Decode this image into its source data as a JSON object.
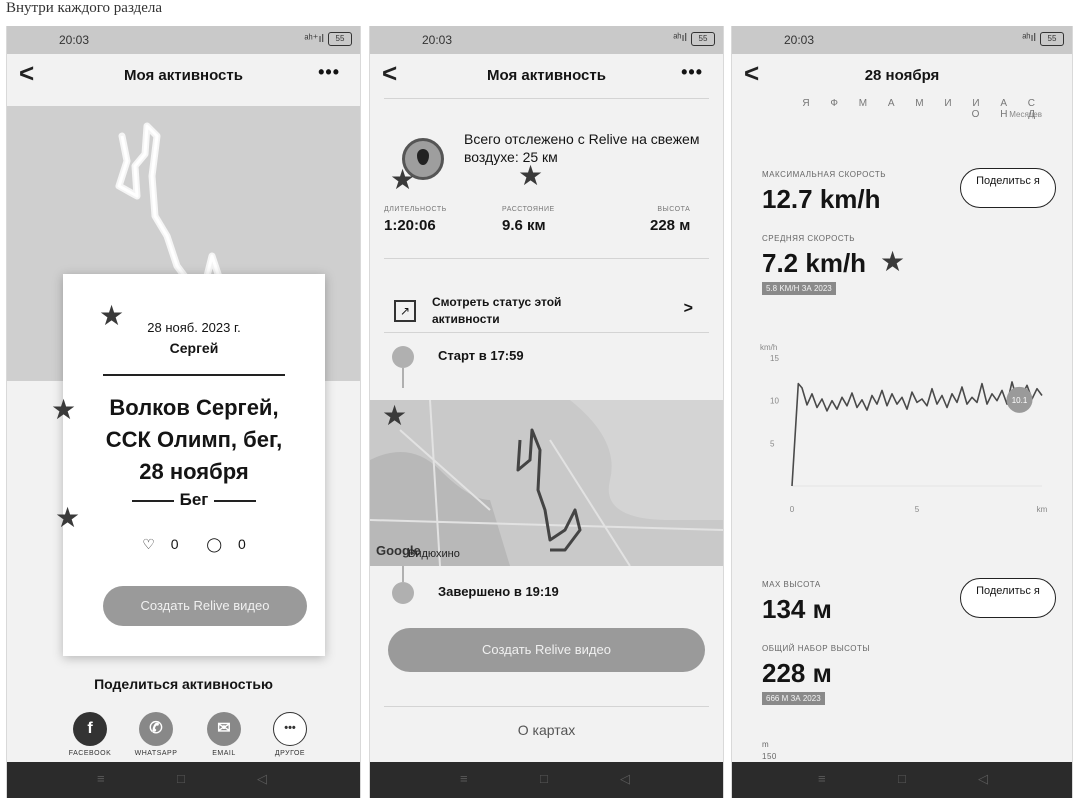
{
  "header_text": "Внутри каждого раздела",
  "screens": [
    {
      "status_time": "20:03",
      "status_signal": "ᵃʰ⁺ıl",
      "status_battery": "55",
      "title": "Моя активность",
      "more": "•••",
      "back": "<",
      "card": {
        "date": "28 нояб. 2023 г.",
        "name": "Сергей",
        "title_lines": [
          "Волков Сергей,",
          "ССК Олимп, бег,",
          "28 ноября"
        ],
        "sport": "Бег",
        "likes": "0",
        "comments": "0",
        "button": "Создать Relive видео"
      },
      "share_title": "Поделиться активностью",
      "share_options": [
        {
          "label": "FACEBOOK",
          "glyph": "f",
          "icon": "facebook-icon"
        },
        {
          "label": "WHATSAPP",
          "glyph": "✆",
          "icon": "whatsapp-icon"
        },
        {
          "label": "EMAIL",
          "glyph": "✉",
          "icon": "email-icon"
        },
        {
          "label": "ДРУГОЕ",
          "glyph": "•••",
          "icon": "more-icon"
        }
      ]
    },
    {
      "status_time": "20:03",
      "status_signal": "ᵃʰıl",
      "status_battery": "55",
      "title": "Моя активность",
      "more": "•••",
      "back": "<",
      "tracked_text": "Всего отслежено с Relive на свежем воздухе: 25 км",
      "stats": [
        {
          "label": "ДЛИТЕЛЬНОСТЬ",
          "value": "1:20:06"
        },
        {
          "label": "РАССТОЯНИЕ",
          "value": "9.6 км"
        },
        {
          "label": "ВЫСОТА",
          "value": "228 м"
        }
      ],
      "status_link": "Смотреть статус этой активности",
      "start": "Старт в 17:59",
      "finish": "Завершено в 19:19",
      "map_place": "Видюхино",
      "map_brand": "Google",
      "button": "Создать Relive видео",
      "about_maps": "О картах"
    },
    {
      "status_time": "20:03",
      "status_signal": "ᵃʰıl",
      "status_battery": "55",
      "title": "28 ноября",
      "back": "<",
      "months": "Я Ф М А М И И А С О Н Д",
      "months_sub": "Месяцев",
      "max_speed_label": "МАКСИМАЛЬНАЯ СКОРОСТЬ",
      "max_speed_value": "12.7 km/h",
      "avg_speed_label": "СРЕДНЯЯ СКОРОСТЬ",
      "avg_speed_value": "7.2 km/h",
      "avg_speed_badge": "5.8 KM/H ЗА 2023",
      "share_button": "Поделитьс я",
      "max_height_label": "МАХ ВЫСОТА",
      "max_height_value": "134 м",
      "gain_label": "ОБЩИЙ НАБОР ВЫСОТЫ",
      "gain_value": "228 м",
      "gain_badge": "666 М ЗА 2023",
      "elev_axis_unit": "m",
      "elev_axis_tick": "150"
    }
  ],
  "chart_data": {
    "type": "line",
    "ylabel": "km/h",
    "xlabel": "km",
    "xlim": [
      0,
      10
    ],
    "ylim": [
      0,
      15
    ],
    "y_ticks": [
      5,
      10,
      15
    ],
    "x_ticks": [
      0,
      5
    ],
    "x_tick_labels": [
      "0",
      "5",
      "km"
    ],
    "grid": false,
    "highlight_label": "10.1",
    "highlight_x": 9.1,
    "highlight_y": 10.1,
    "series": [
      {
        "x": [
          0,
          0.25,
          0.4,
          0.6,
          0.8,
          1.0,
          1.2,
          1.4,
          1.6,
          1.8,
          2.0,
          2.2,
          2.4,
          2.6,
          2.8,
          3.0,
          3.2,
          3.4,
          3.6,
          3.8,
          4.0,
          4.2,
          4.4,
          4.6,
          4.8,
          5.0,
          5.2,
          5.4,
          5.6,
          5.8,
          6.0,
          6.2,
          6.4,
          6.6,
          6.8,
          7.0,
          7.2,
          7.4,
          7.6,
          7.8,
          8.0,
          8.2,
          8.4,
          8.6,
          8.8,
          9.0,
          9.2,
          9.4,
          9.6,
          9.8,
          10.0
        ],
        "values": [
          0,
          12.0,
          11.5,
          9.5,
          10.8,
          9.2,
          10.2,
          8.8,
          10.0,
          9.0,
          10.4,
          9.4,
          10.9,
          9.2,
          10.1,
          8.9,
          10.6,
          9.6,
          11.2,
          9.4,
          10.8,
          9.6,
          10.4,
          9.0,
          11.0,
          9.8,
          10.2,
          9.4,
          11.4,
          9.6,
          10.6,
          9.2,
          10.8,
          9.8,
          11.6,
          9.6,
          10.4,
          9.8,
          12.0,
          9.6,
          10.8,
          10.0,
          11.2,
          9.6,
          12.2,
          10.1,
          10.6,
          11.8,
          10.2,
          11.4,
          10.6
        ]
      }
    ]
  }
}
